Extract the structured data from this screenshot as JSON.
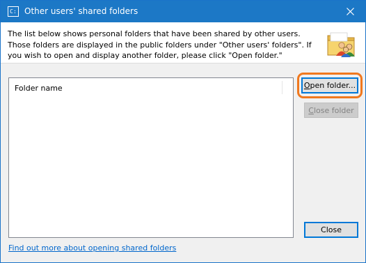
{
  "window": {
    "title": "Other users' shared folders",
    "title_icon_text": "C:"
  },
  "header": {
    "description": "The list below shows personal folders that have been shared by other users. Those folders are displayed in the public folders under \"Other users' folders\". If you wish to open and display another folder, please click \"Open folder.\""
  },
  "list": {
    "column_header": "Folder name",
    "rows": []
  },
  "buttons": {
    "open_folder_access_key": "O",
    "open_folder_rest": "pen folder...",
    "close_folder_access_key": "C",
    "close_folder_rest": "lose folder",
    "close": "Close"
  },
  "footer": {
    "help_link": "Find out more about opening shared folders"
  },
  "icons": {
    "title": "app-icon",
    "close": "close-icon",
    "header": "shared-folder-users-icon"
  },
  "colors": {
    "titlebar": "#1c78c6",
    "highlight": "#f0781e",
    "link": "#0066cc"
  }
}
